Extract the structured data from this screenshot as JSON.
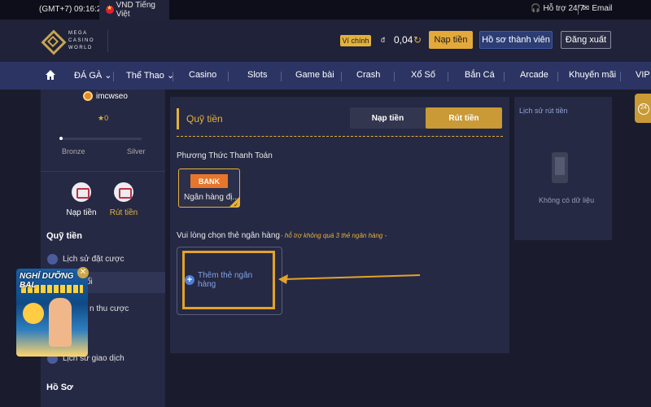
{
  "topbar": {
    "time": "(GMT+7) 09:16:28",
    "lang": "VND Tiếng Việt",
    "support": "Hỗ trợ 24/7",
    "email": "Email"
  },
  "header": {
    "logo_lines": [
      "MEGA",
      "CASINO",
      "WORLD"
    ],
    "wallet_label": "Ví chính",
    "wallet_unit": "đ",
    "wallet_balance": "0,04",
    "deposit_button": "Nạp tiền",
    "profile_button": "Hồ sơ thành viên",
    "logout_button": "Đăng xuất"
  },
  "nav": {
    "items": [
      "ĐÁ GÀ",
      "Thể Thao",
      "Casino",
      "Slots",
      "Game bài",
      "Crash",
      "Xổ Số",
      "Bắn Cá",
      "Arcade",
      "Khuyến mãi",
      "VIP"
    ]
  },
  "sidebar": {
    "username": "imcwseo",
    "stars": "★0",
    "level_from": "Bronze",
    "level_to": "Silver",
    "action_deposit": "Nạp tiền",
    "action_withdraw": "Rút tiền",
    "section_funds": "Quỹ tiền",
    "link_bet_history": "Lịch sử đặt cược",
    "link_partial_1": "ổi",
    "link_partial_2": "n thu cược",
    "link_transaction_history": "Lịch sử giao dịch",
    "section_profile": "Hồ Sơ"
  },
  "main": {
    "title": "Quỹ tiền",
    "tab_deposit": "Nạp tiền",
    "tab_withdraw": "Rút tiền",
    "payment_method_title": "Phương Thức Thanh Toán",
    "bank_logo": "BANK",
    "bank_name": "Ngân hàng đị...",
    "choose_card_title": "Vui lòng chọn thẻ ngân hàng",
    "card_note": "- hỗ trợ không quá 3 thẻ ngân hàng -",
    "add_card": "Thêm thẻ ngân hàng"
  },
  "history": {
    "title": "Lịch sử rút tiền",
    "empty": "Không có dữ liệu"
  },
  "promo": {
    "title": "NGHỈ DƯỠNG BAL"
  },
  "colors": {
    "accent": "#e3b23c",
    "nav_bg": "#2c3463",
    "panel_bg": "#262944",
    "page_bg": "#1a1c2e"
  }
}
